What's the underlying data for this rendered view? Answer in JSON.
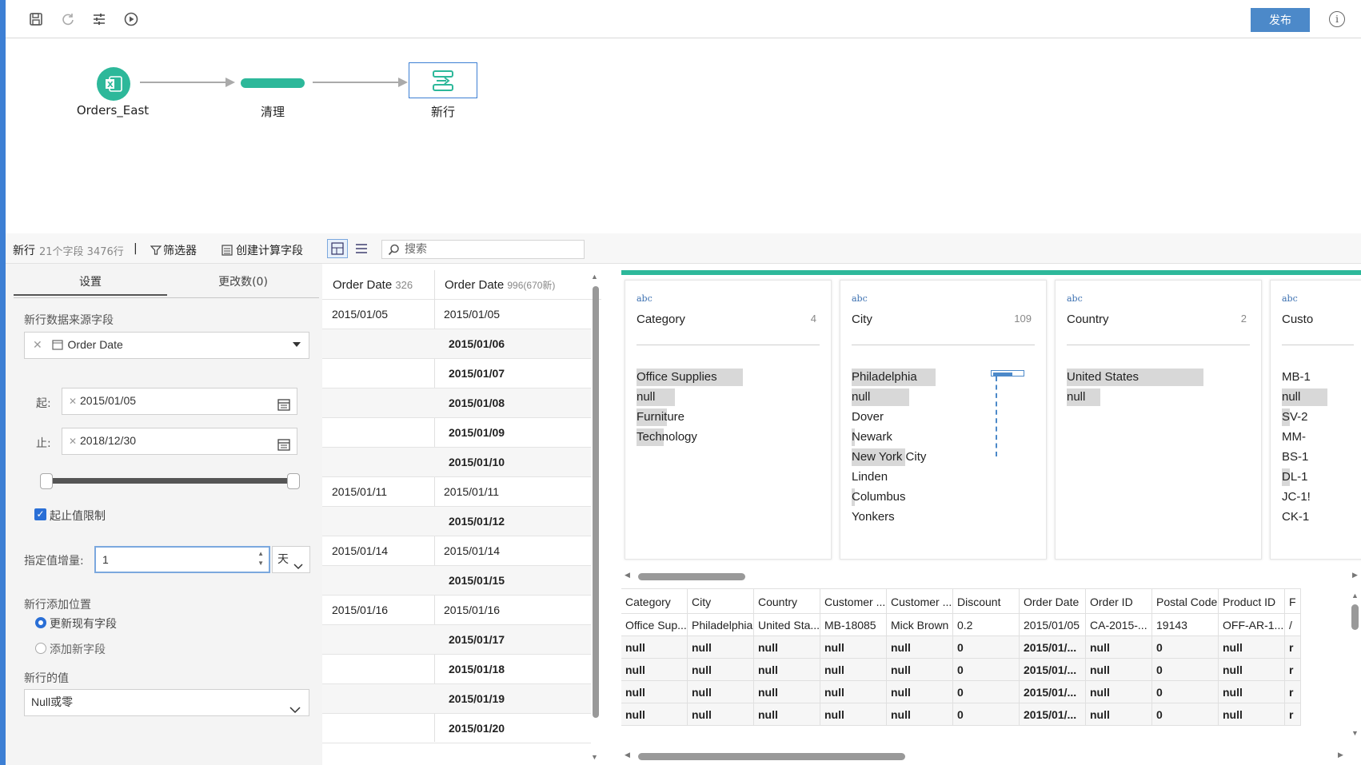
{
  "toolbar": {
    "icons": [
      "save-icon",
      "refresh-icon",
      "settings-sliders-icon",
      "play-icon"
    ],
    "publish_label": "发布",
    "info_glyph": "i"
  },
  "flow": {
    "nodes": [
      {
        "label": "Orders_East",
        "icon": "excel-icon"
      },
      {
        "label": "清理",
        "icon": "clean-bar"
      },
      {
        "label": "新行",
        "icon": "new-rows-icon"
      }
    ]
  },
  "stepbar": {
    "step_name": "新行",
    "fields_text": "21个字段 3476行",
    "separator": "|",
    "filter_label": "筛选器",
    "calc_field_label": "创建计算字段",
    "search_placeholder": "搜索"
  },
  "settings": {
    "tabs": [
      {
        "label": "设置"
      },
      {
        "label": "更改数(0)"
      }
    ],
    "source_field_label": "新行数据来源字段",
    "source_field_value": "Order Date",
    "from_label": "起:",
    "from_value": "2015/01/05",
    "to_label": "止:",
    "to_value": "2018/12/30",
    "range_limit_label": "起止值限制",
    "range_limit_checked": true,
    "increment_label": "指定值增量:",
    "increment_value": "1",
    "increment_unit": "天",
    "position_label": "新行添加位置",
    "position_options": [
      "更新现有字段",
      "添加新字段"
    ],
    "position_selected": "更新现有字段",
    "new_value_label": "新行的值",
    "new_value_selected": "Null或零"
  },
  "date_columns": {
    "col1_header": "Order Date",
    "col1_count": "326",
    "col2_header": "Order Date",
    "col2_count": "996(670新)",
    "rows": [
      {
        "orig": "2015/01/05",
        "new": "2015/01/05",
        "added": false
      },
      {
        "orig": "",
        "new": "2015/01/06",
        "added": true
      },
      {
        "orig": "",
        "new": "2015/01/07",
        "added": true
      },
      {
        "orig": "",
        "new": "2015/01/08",
        "added": true
      },
      {
        "orig": "",
        "new": "2015/01/09",
        "added": true
      },
      {
        "orig": "",
        "new": "2015/01/10",
        "added": true
      },
      {
        "orig": "2015/01/11",
        "new": "2015/01/11",
        "added": false
      },
      {
        "orig": "",
        "new": "2015/01/12",
        "added": true
      },
      {
        "orig": "2015/01/14",
        "new": "2015/01/14",
        "added": false
      },
      {
        "orig": "",
        "new": "2015/01/15",
        "added": true
      },
      {
        "orig": "2015/01/16",
        "new": "2015/01/16",
        "added": false
      },
      {
        "orig": "",
        "new": "2015/01/17",
        "added": true
      },
      {
        "orig": "",
        "new": "2015/01/18",
        "added": true
      },
      {
        "orig": "",
        "new": "2015/01/19",
        "added": true
      },
      {
        "orig": "",
        "new": "2015/01/20",
        "added": true
      }
    ]
  },
  "profiles": [
    {
      "type": "abc",
      "name": "Category",
      "count": "4",
      "values": [
        {
          "text": "Office Supplies",
          "bar": 0.7
        },
        {
          "text": "null",
          "bar": 0.25
        },
        {
          "text": "Furniture",
          "bar": 0.2
        },
        {
          "text": "Technology",
          "bar": 0.18
        }
      ]
    },
    {
      "type": "abc",
      "name": "City",
      "count": "109",
      "values": [
        {
          "text": "Philadelphia",
          "bar": 0.55
        },
        {
          "text": "null",
          "bar": 0.38
        },
        {
          "text": "Dover",
          "bar": 0
        },
        {
          "text": "Newark",
          "bar": 0.02
        },
        {
          "text": "New York City",
          "bar": 0.35
        },
        {
          "text": "Linden",
          "bar": 0
        },
        {
          "text": "Columbus",
          "bar": 0.02
        },
        {
          "text": "Yonkers",
          "bar": 0
        }
      ]
    },
    {
      "type": "abc",
      "name": "Country",
      "count": "2",
      "values": [
        {
          "text": "United States",
          "bar": 0.9
        },
        {
          "text": "null",
          "bar": 0.22
        }
      ]
    },
    {
      "type": "abc",
      "name": "Custo",
      "count": "",
      "values": [
        {
          "text": "MB-1",
          "bar": 0
        },
        {
          "text": "null",
          "bar": 0.3
        },
        {
          "text": "SV-2",
          "bar": 0.05
        },
        {
          "text": "MM-",
          "bar": 0
        },
        {
          "text": "BS-1",
          "bar": 0
        },
        {
          "text": "DL-1",
          "bar": 0.05
        },
        {
          "text": "JC-1!",
          "bar": 0
        },
        {
          "text": "CK-1",
          "bar": 0
        }
      ]
    }
  ],
  "grid": {
    "headers": [
      "Category",
      "City",
      "Country",
      "Customer ...",
      "Customer ...",
      "Discount",
      "Order Date",
      "Order ID",
      "Postal Code",
      "Product ID",
      "F"
    ],
    "rows": [
      [
        "Office Sup...",
        "Philadelphia",
        "United Sta...",
        "MB-18085",
        "Mick Brown",
        "0.2",
        "2015/01/05",
        "CA-2015-...",
        "19143",
        "OFF-AR-1...",
        "/"
      ],
      [
        "null",
        "null",
        "null",
        "null",
        "null",
        "0",
        "2015/01/...",
        "null",
        "0",
        "null",
        "r"
      ],
      [
        "null",
        "null",
        "null",
        "null",
        "null",
        "0",
        "2015/01/...",
        "null",
        "0",
        "null",
        "r"
      ],
      [
        "null",
        "null",
        "null",
        "null",
        "null",
        "0",
        "2015/01/...",
        "null",
        "0",
        "null",
        "r"
      ],
      [
        "null",
        "null",
        "null",
        "null",
        "null",
        "0",
        "2015/01/...",
        "null",
        "0",
        "null",
        "r"
      ]
    ],
    "bold_rows": [
      1,
      2,
      3,
      4
    ]
  },
  "colors": {
    "accent": "#2db89a",
    "brand_blue": "#4c89c9",
    "side_strip": "#3d7fd4"
  }
}
